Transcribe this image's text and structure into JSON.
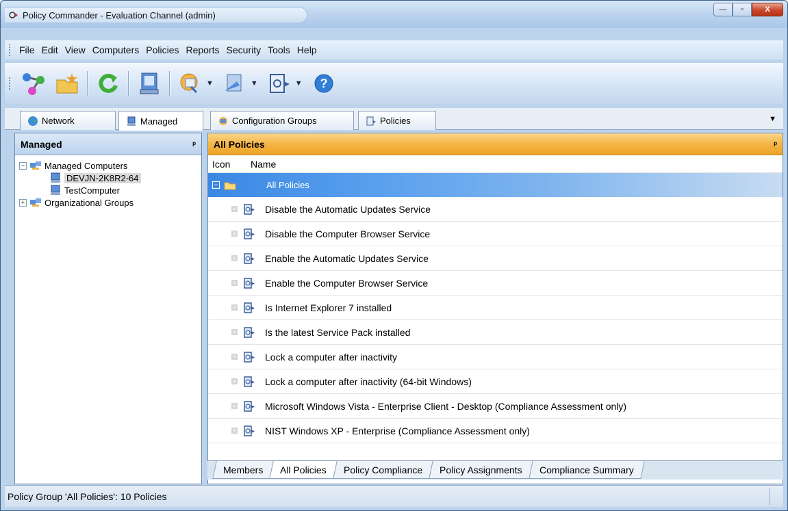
{
  "window": {
    "title": "Policy Commander - Evaluation Channel (admin)",
    "controls": {
      "minimize": "—",
      "maximize": "▫",
      "close": "X"
    }
  },
  "menu": [
    "File",
    "Edit",
    "View",
    "Computers",
    "Policies",
    "Reports",
    "Security",
    "Tools",
    "Help"
  ],
  "toolbar": {
    "buttons": [
      {
        "icon": "network-connect-icon"
      },
      {
        "icon": "folder-star-icon"
      },
      {
        "icon": "refresh-icon"
      },
      {
        "icon": "computer-icon"
      },
      {
        "icon": "config-group-icon",
        "dropdown": true
      },
      {
        "icon": "deploy-icon",
        "dropdown": true
      },
      {
        "icon": "policy-icon",
        "dropdown": true
      },
      {
        "icon": "help-icon"
      }
    ]
  },
  "tabs": [
    {
      "label": "Network",
      "icon": "globe-icon"
    },
    {
      "label": "Managed",
      "icon": "computer-icon",
      "active": true
    },
    {
      "label": "Configuration Groups",
      "icon": "config-group-icon"
    },
    {
      "label": "Policies",
      "icon": "policy-icon"
    }
  ],
  "left_panel": {
    "title": "Managed",
    "pin": "ᵖ",
    "tree": {
      "managed_computers": "Managed Computers",
      "computer_1": "DEVJN-2K8R2-64",
      "computer_2": "TestComputer",
      "org_groups": "Organizational Groups"
    }
  },
  "right_panel": {
    "title": "All Policies",
    "pin": "ᵖ",
    "columns": {
      "icon": "Icon",
      "name": "Name"
    },
    "group": "All Policies",
    "policies": [
      "Disable the Automatic Updates Service",
      "Disable the Computer Browser Service",
      "Enable the Automatic Updates Service",
      "Enable the Computer Browser Service",
      "Is Internet Explorer 7 installed",
      "Is the latest Service Pack installed",
      "Lock a computer after inactivity",
      "Lock a computer after inactivity (64-bit Windows)",
      "Microsoft Windows Vista - Enterprise Client - Desktop (Compliance Assessment only)",
      "NIST Windows XP - Enterprise (Compliance Assessment only)"
    ],
    "bottom_tabs": [
      {
        "label": "Members"
      },
      {
        "label": "All Policies",
        "active": true
      },
      {
        "label": "Policy Compliance"
      },
      {
        "label": "Policy Assignments"
      },
      {
        "label": "Compliance Summary"
      }
    ]
  },
  "status": "Policy Group 'All Policies': 10 Policies",
  "colors": {
    "accent_orange": "#f4b342",
    "selection_blue": "#3b88e4"
  }
}
